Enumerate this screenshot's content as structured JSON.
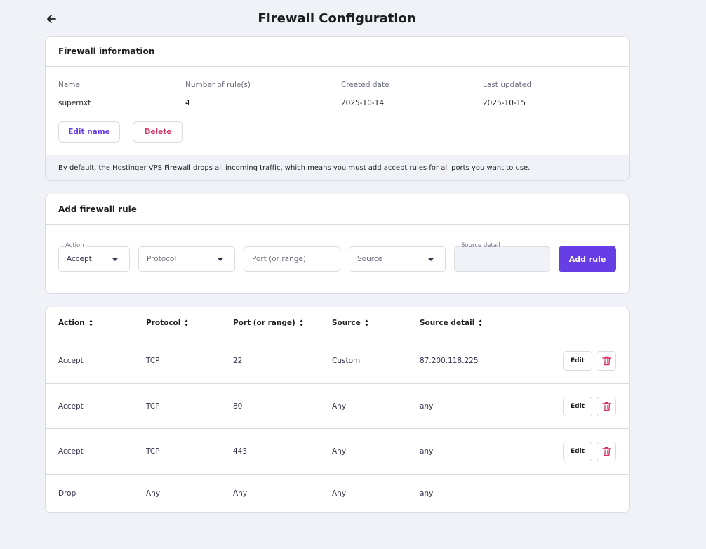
{
  "header": {
    "title": "Firewall Configuration",
    "back_icon": "arrow-left-icon"
  },
  "info": {
    "title": "Firewall information",
    "name_label": "Name",
    "name_value": "supernxt",
    "rules_label": "Number of rule(s)",
    "rules_value": "4",
    "created_label": "Created date",
    "created_value": "2025-10-14",
    "updated_label": "Last updated",
    "updated_value": "2025-10-15",
    "edit_name_label": "Edit name",
    "delete_label": "Delete",
    "note": "By default, the Hostinger VPS Firewall drops all incoming traffic, which means you must add accept rules for all ports you want to use."
  },
  "add_rule": {
    "title": "Add firewall rule",
    "action_label": "Action",
    "action_value": "Accept",
    "protocol_placeholder": "Protocol",
    "port_placeholder": "Port (or range)",
    "source_placeholder": "Source",
    "source_detail_label": "Source detail",
    "submit_label": "Add rule"
  },
  "table": {
    "columns": [
      "Action",
      "Protocol",
      "Port (or range)",
      "Source",
      "Source detail"
    ],
    "rows": [
      {
        "action": "Accept",
        "protocol": "TCP",
        "port": "22",
        "source": "Custom",
        "detail": "87.200.118.225",
        "edit": "Edit"
      },
      {
        "action": "Accept",
        "protocol": "TCP",
        "port": "80",
        "source": "Any",
        "detail": "any",
        "edit": "Edit"
      },
      {
        "action": "Accept",
        "protocol": "TCP",
        "port": "443",
        "source": "Any",
        "detail": "any",
        "edit": "Edit"
      },
      {
        "action": "Drop",
        "protocol": "Any",
        "port": "Any",
        "source": "Any",
        "detail": "any"
      }
    ]
  },
  "colors": {
    "primary": "#673de6",
    "danger": "#d63163",
    "background": "#f1f2f7",
    "text": "#1d1e20"
  }
}
